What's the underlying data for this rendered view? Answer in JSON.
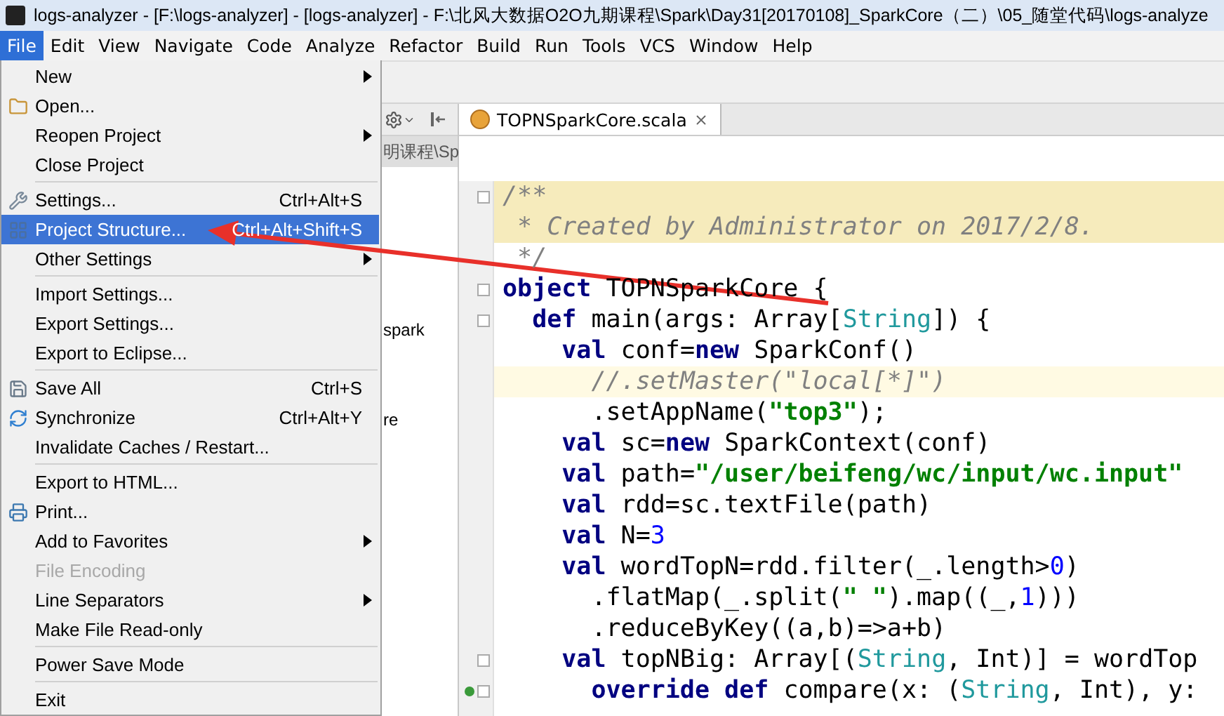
{
  "window": {
    "title": "logs-analyzer - [F:\\logs-analyzer] - [logs-analyzer] - F:\\北风大数据O2O九期课程\\Spark\\Day31[20170108]_SparkCore（二）\\05_随堂代码\\logs-analyze"
  },
  "menubar": [
    {
      "label": "File",
      "selected": true
    },
    {
      "label": "Edit",
      "selected": false
    },
    {
      "label": "View",
      "selected": false
    },
    {
      "label": "Navigate",
      "selected": false
    },
    {
      "label": "Code",
      "selected": false
    },
    {
      "label": "Analyze",
      "selected": false
    },
    {
      "label": "Refactor",
      "selected": false
    },
    {
      "label": "Build",
      "selected": false
    },
    {
      "label": "Run",
      "selected": false
    },
    {
      "label": "Tools",
      "selected": false
    },
    {
      "label": "VCS",
      "selected": false
    },
    {
      "label": "Window",
      "selected": false
    },
    {
      "label": "Help",
      "selected": false
    }
  ],
  "project_panel": {
    "rows": [
      {
        "label": "明课程\\Sp",
        "selected": true
      },
      {
        "label": "spark",
        "selected": false
      },
      {
        "label": "re",
        "selected": false
      }
    ]
  },
  "file_menu": {
    "groups": [
      [
        {
          "label": "New",
          "submenu": true,
          "selected": false,
          "disabled": false
        },
        {
          "label": "Open...",
          "selected": false,
          "disabled": false
        },
        {
          "label": "Reopen Project",
          "submenu": true,
          "selected": false,
          "disabled": false
        },
        {
          "label": "Close Project",
          "selected": false,
          "disabled": false
        }
      ],
      [
        {
          "label": "Settings...",
          "shortcut": "Ctrl+Alt+S",
          "selected": false,
          "disabled": false
        },
        {
          "label": "Project Structure...",
          "shortcut": "Ctrl+Alt+Shift+S",
          "selected": true,
          "disabled": false
        },
        {
          "label": "Other Settings",
          "submenu": true,
          "selected": false,
          "disabled": false
        }
      ],
      [
        {
          "label": "Import Settings...",
          "selected": false,
          "disabled": false
        },
        {
          "label": "Export Settings...",
          "selected": false,
          "disabled": false
        },
        {
          "label": "Export to Eclipse...",
          "selected": false,
          "disabled": false
        }
      ],
      [
        {
          "label": "Save All",
          "shortcut": "Ctrl+S",
          "selected": false,
          "disabled": false
        },
        {
          "label": "Synchronize",
          "shortcut": "Ctrl+Alt+Y",
          "selected": false,
          "disabled": false
        },
        {
          "label": "Invalidate Caches / Restart...",
          "selected": false,
          "disabled": false
        }
      ],
      [
        {
          "label": "Export to HTML...",
          "selected": false,
          "disabled": false
        },
        {
          "label": "Print...",
          "selected": false,
          "disabled": false
        },
        {
          "label": "Add to Favorites",
          "submenu": true,
          "selected": false,
          "disabled": false
        },
        {
          "label": "File Encoding",
          "selected": false,
          "disabled": true
        },
        {
          "label": "Line Separators",
          "submenu": true,
          "selected": false,
          "disabled": false
        },
        {
          "label": "Make File Read-only",
          "selected": false,
          "disabled": false
        }
      ],
      [
        {
          "label": "Power Save Mode",
          "selected": false,
          "disabled": false
        }
      ],
      [
        {
          "label": "Exit",
          "selected": false,
          "disabled": false
        }
      ]
    ]
  },
  "editor": {
    "tab": {
      "label": "TOPNSparkCore.scala",
      "selected": true
    },
    "lines": [
      {
        "doc_band": true,
        "fold": true,
        "tokens": [
          {
            "kind": "comment",
            "text": "/**"
          }
        ]
      },
      {
        "doc_band": true,
        "tokens": [
          {
            "kind": "comment",
            "text": " * Created by Administrator on 2017/2/8."
          }
        ]
      },
      {
        "tokens": [
          {
            "kind": "comment",
            "text": " */"
          }
        ]
      },
      {
        "fold": true,
        "tokens": [
          {
            "kind": "kw",
            "text": "object"
          },
          {
            "kind": "plain",
            "text": " TOPNSparkCore {"
          }
        ]
      },
      {
        "fold": true,
        "tokens": [
          {
            "kind": "kw",
            "text": "  def"
          },
          {
            "kind": "plain",
            "text": " main(args: Array["
          },
          {
            "kind": "type",
            "text": "String"
          },
          {
            "kind": "plain",
            "text": "]) {"
          }
        ]
      },
      {
        "tokens": [
          {
            "kind": "kw",
            "text": "    val"
          },
          {
            "kind": "plain",
            "text": " conf="
          },
          {
            "kind": "kw",
            "text": "new"
          },
          {
            "kind": "plain",
            "text": " SparkConf()"
          }
        ]
      },
      {
        "current_line": true,
        "tokens": [
          {
            "kind": "comment",
            "text": "      //.setMaster(\"local[*]\")"
          }
        ]
      },
      {
        "tokens": [
          {
            "kind": "plain",
            "text": "      .setAppName("
          },
          {
            "kind": "str",
            "text": "\"top3\""
          },
          {
            "kind": "plain",
            "text": ");"
          }
        ]
      },
      {
        "tokens": [
          {
            "kind": "kw",
            "text": "    val"
          },
          {
            "kind": "plain",
            "text": " sc="
          },
          {
            "kind": "kw",
            "text": "new"
          },
          {
            "kind": "plain",
            "text": " SparkContext(conf)"
          }
        ]
      },
      {
        "tokens": [
          {
            "kind": "kw",
            "text": "    val"
          },
          {
            "kind": "plain",
            "text": " path="
          },
          {
            "kind": "str",
            "text": "\"/user/beifeng/wc/input/wc.input\""
          }
        ]
      },
      {
        "tokens": [
          {
            "kind": "kw",
            "text": "    val"
          },
          {
            "kind": "plain",
            "text": " rdd=sc.textFile(path)"
          }
        ]
      },
      {
        "tokens": [
          {
            "kind": "kw",
            "text": "    val"
          },
          {
            "kind": "plain",
            "text": " N="
          },
          {
            "kind": "num",
            "text": "3"
          }
        ]
      },
      {
        "tokens": [
          {
            "kind": "kw",
            "text": "    val"
          },
          {
            "kind": "plain",
            "text": " wordTopN=rdd.filter(_.length>"
          },
          {
            "kind": "num",
            "text": "0"
          },
          {
            "kind": "plain",
            "text": ")"
          }
        ]
      },
      {
        "tokens": [
          {
            "kind": "plain",
            "text": "      .flatMap(_.split("
          },
          {
            "kind": "str",
            "text": "\" \""
          },
          {
            "kind": "plain",
            "text": ").map((_,"
          },
          {
            "kind": "num",
            "text": "1"
          },
          {
            "kind": "plain",
            "text": ")))"
          }
        ]
      },
      {
        "tokens": [
          {
            "kind": "plain",
            "text": "      .reduceByKey((a,b)=>a+b)"
          }
        ]
      },
      {
        "fold": true,
        "tokens": [
          {
            "kind": "kw",
            "text": "    val"
          },
          {
            "kind": "plain",
            "text": " topNBig: Array[("
          },
          {
            "kind": "type",
            "text": "String"
          },
          {
            "kind": "plain",
            "text": ", Int)] = wordTop"
          }
        ]
      },
      {
        "fold": true,
        "override": true,
        "tokens": [
          {
            "kind": "kw",
            "text": "      override def"
          },
          {
            "kind": "plain",
            "text": " compare(x: ("
          },
          {
            "kind": "type",
            "text": "String"
          },
          {
            "kind": "plain",
            "text": ", Int), y:"
          }
        ]
      }
    ]
  }
}
